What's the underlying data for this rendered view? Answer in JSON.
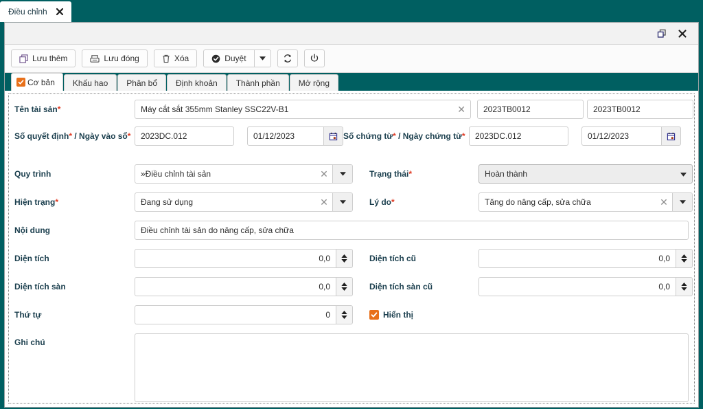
{
  "page_tab": {
    "title": "Điều chỉnh",
    "close_icon": "close-icon"
  },
  "window": {
    "restore_icon": "restore-window-icon",
    "close_icon": "close-window-icon"
  },
  "toolbar": {
    "save_add_label": "Lưu thêm",
    "save_close_label": "Lưu đóng",
    "delete_label": "Xóa",
    "approve_label": "Duyệt",
    "approve_caret_icon": "chevron-down-icon",
    "refresh_icon": "refresh-icon",
    "power_icon": "power-icon"
  },
  "tabs": [
    {
      "label": "Cơ bản",
      "active": true
    },
    {
      "label": "Khấu hao",
      "active": false
    },
    {
      "label": "Phân bổ",
      "active": false
    },
    {
      "label": "Định khoản",
      "active": false
    },
    {
      "label": "Thành phần",
      "active": false
    },
    {
      "label": "Mở rộng",
      "active": false
    }
  ],
  "form": {
    "asset_name": {
      "label": "Tên tài sản",
      "required": "*",
      "value": "Máy cắt sắt 355mm Stanley SSC22V-B1",
      "clear_icon": "clear-icon"
    },
    "asset_code_1": {
      "value": "2023TB0012"
    },
    "asset_code_2": {
      "value": "2023TB0012"
    },
    "decision_no": {
      "label_part1": "Số quyết định",
      "req1": "*",
      "label_sep": "/",
      "label_part2": "Ngày vào sổ",
      "req2": "*",
      "value": "2023DC.012",
      "date_value": "01/12/2023",
      "calendar_icon": "calendar-icon"
    },
    "voucher_no": {
      "label_part1": "Số chứng từ",
      "req1": "*",
      "label_sep": "/",
      "label_part2": "Ngày chứng từ",
      "req2": "*",
      "value": "2023DC.012",
      "date_value": "01/12/2023",
      "calendar_icon": "calendar-icon"
    },
    "process": {
      "label": "Quy trình",
      "value": "»Điều chỉnh tài sản",
      "clear_icon": "clear-icon",
      "caret_icon": "chevron-down-icon"
    },
    "status": {
      "label": "Trạng thái",
      "required": "*",
      "value": "Hoàn thành",
      "caret_icon": "chevron-down-icon"
    },
    "condition": {
      "label": "Hiện trạng",
      "required": "*",
      "value": "Đang sử dụng",
      "clear_icon": "clear-icon",
      "caret_icon": "chevron-down-icon"
    },
    "reason": {
      "label": "Lý do",
      "required": "*",
      "value": "Tăng do nâng cấp, sửa chữa",
      "clear_icon": "clear-icon",
      "caret_icon": "chevron-down-icon"
    },
    "content": {
      "label": "Nội dung",
      "value": "Điều chỉnh tài sản do nâng cấp, sửa chữa"
    },
    "area": {
      "label": "Diện tích",
      "value": "0,0"
    },
    "area_old": {
      "label": "Diện tích cũ",
      "value": "0,0"
    },
    "floor_area": {
      "label": "Diện tích sàn",
      "value": "0,0"
    },
    "floor_area_old": {
      "label": "Diện tích sàn cũ",
      "value": "0,0"
    },
    "order": {
      "label": "Thứ tự",
      "value": "0"
    },
    "display": {
      "label": "Hiển thị",
      "checked": true
    },
    "note": {
      "label": "Ghi chú",
      "value": ""
    }
  },
  "colors": {
    "brand_teal": "#005f61",
    "accent_orange": "#e8701a",
    "label_blue": "#1a3e4d",
    "required_red": "#e03b24"
  }
}
